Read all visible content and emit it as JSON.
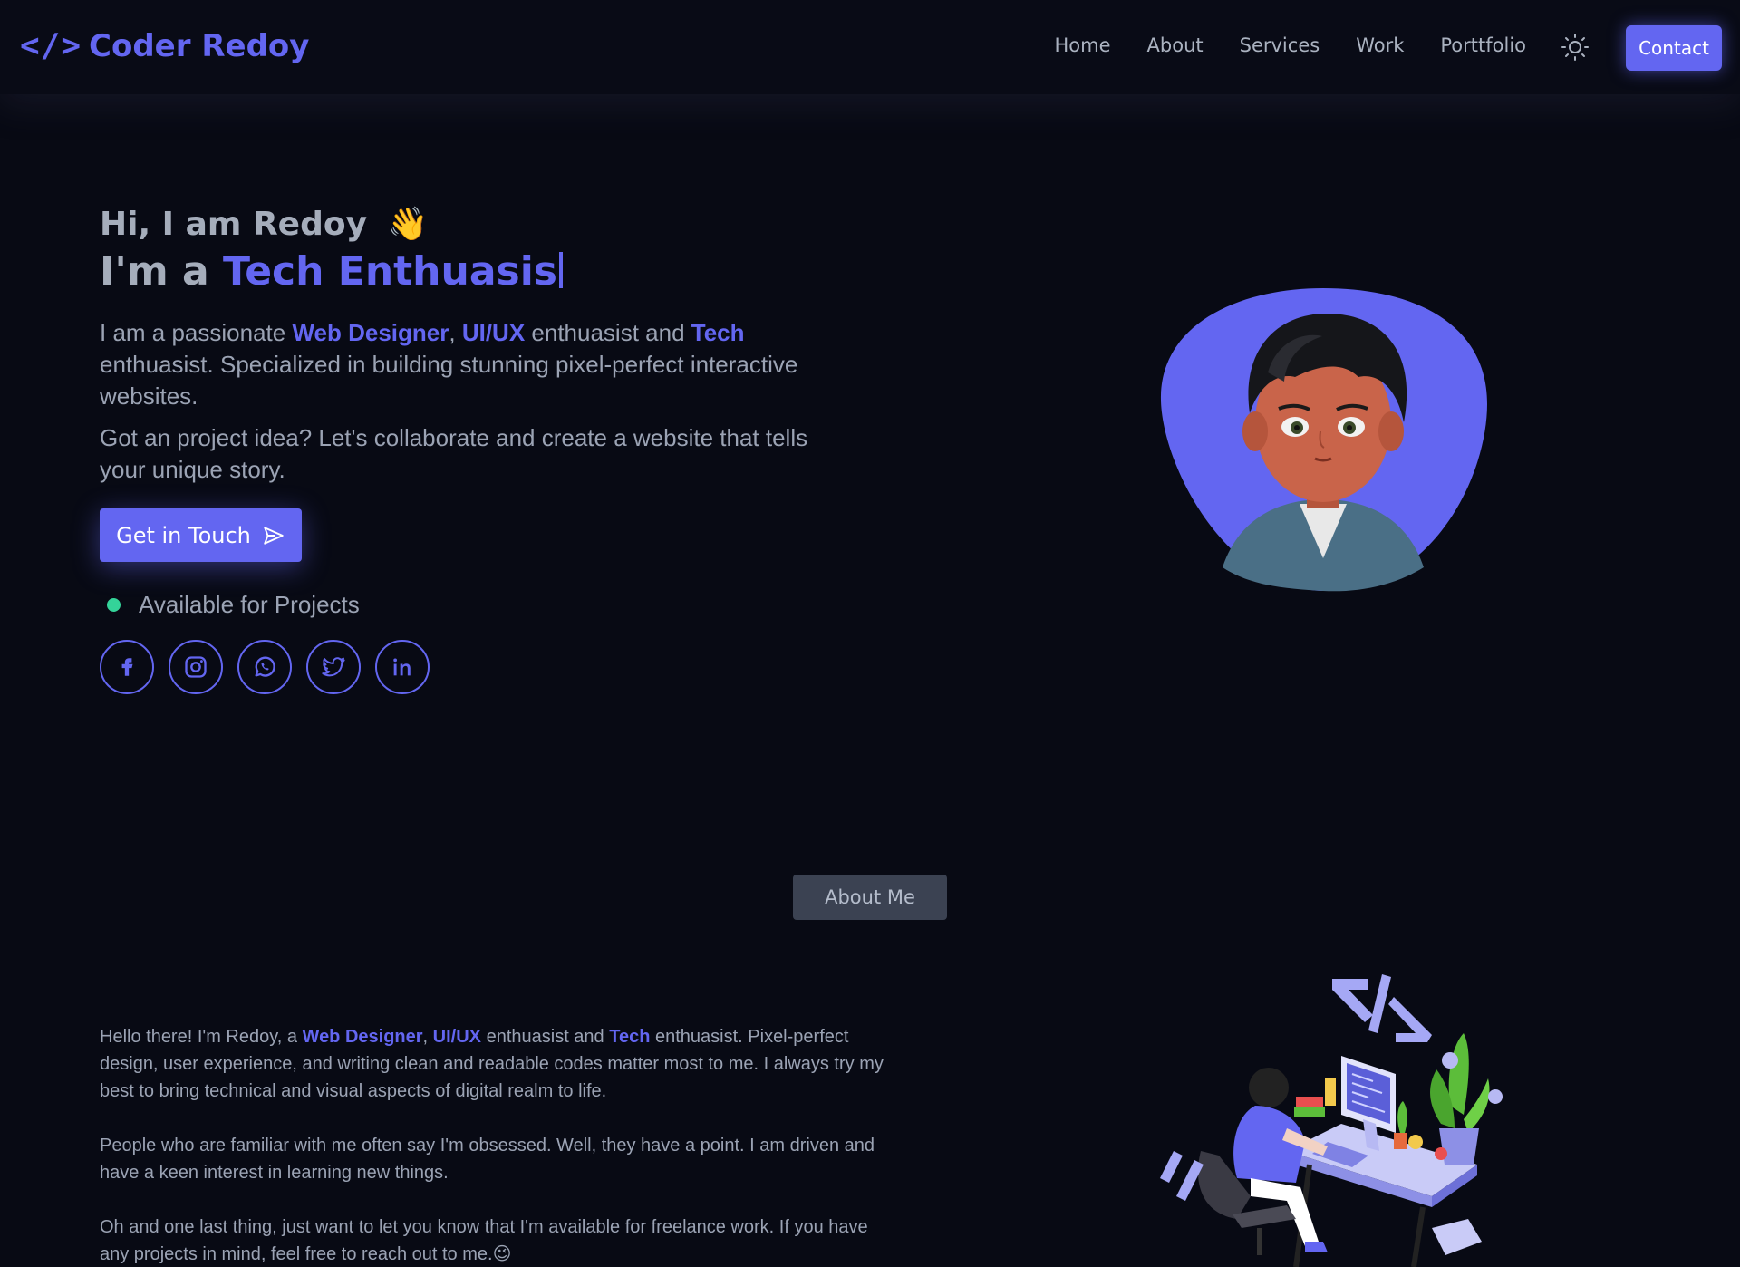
{
  "nav": {
    "logo_mark": "</>",
    "logo_text": "Coder Redoy",
    "links": [
      "Home",
      "About",
      "Services",
      "Work",
      "Porttfolio"
    ],
    "theme_icon": "sun-icon",
    "contact_label": "Contact"
  },
  "hero": {
    "greeting": "Hi, I am Redoy",
    "wave_emoji": "👋",
    "role_prefix": "I'm a ",
    "role_typed": "Tech Enthuasis",
    "intro": {
      "t1": "I am a passionate ",
      "h1": "Web Designer",
      "t2": ", ",
      "h2": "UI/UX",
      "t3": " enthuasist and ",
      "h3": "Tech",
      "t4": " enthuasist. Specialized in building stunning pixel-perfect interactive websites."
    },
    "intro2": "Got an project idea? Let's collaborate and create a website that tells your unique story.",
    "cta_label": "Get in Touch",
    "availability": "Available for Projects",
    "socials": [
      "facebook-icon",
      "instagram-icon",
      "whatsapp-icon",
      "twitter-icon",
      "linkedin-icon"
    ]
  },
  "about": {
    "badge": "About Me",
    "p1": {
      "t1": "Hello there! I'm Redoy, a ",
      "h1": "Web Designer",
      "t2": ", ",
      "h2": "UI/UX",
      "t3": " enthuasist and ",
      "h3": "Tech",
      "t4": " enthuasist. Pixel-perfect design, user experience, and writing clean and readable codes matter most to me. I always try my best to bring technical and visual aspects of digital realm to life."
    },
    "p2": "People who are familiar with me often say I'm obsessed. Well, they have a point. I am driven and have a keen interest in learning new things.",
    "p3": "Oh and one last thing, just want to let you know that I'm available for freelance work. If you have any projects in mind, feel free to reach out to me.",
    "p3_emoji": "😉"
  },
  "colors": {
    "accent": "#6366f1",
    "background": "#080a14",
    "available": "#34d399"
  }
}
